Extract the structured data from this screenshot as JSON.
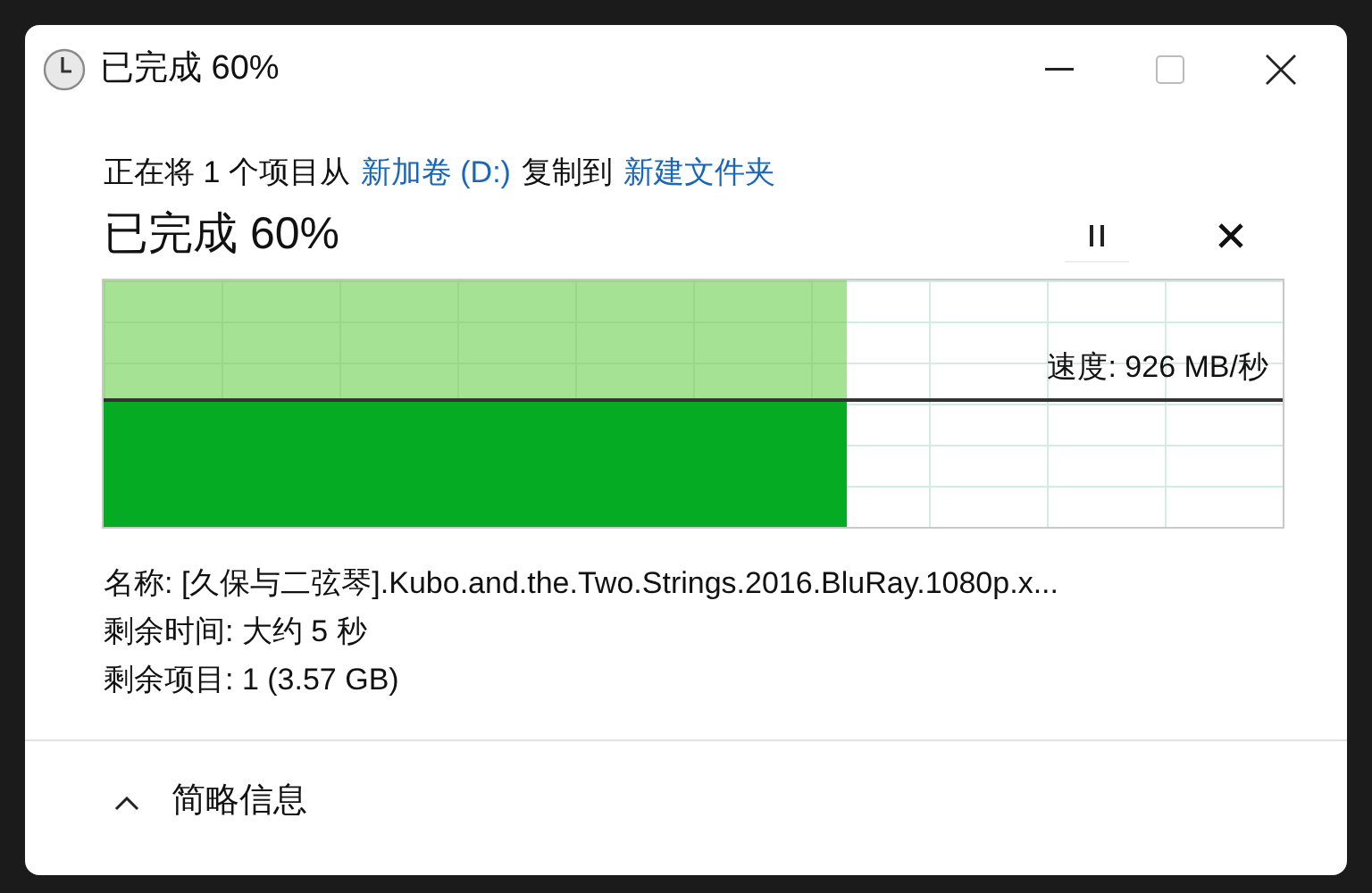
{
  "window": {
    "title": "已完成 60%"
  },
  "header": {
    "parts": [
      {
        "kind": "text",
        "text": "正在将 1 个项目从"
      },
      {
        "kind": "link",
        "text": "新加卷 (D:)"
      },
      {
        "kind": "text",
        "text": "复制到"
      },
      {
        "kind": "link",
        "text": "新建文件夹"
      }
    ]
  },
  "progress": {
    "title": "已完成 60%",
    "speed": "速度: 926 MB/秒"
  },
  "details": [
    "名称: [久保与二弦琴].Kubo.and.the.Two.Strings.2016.BluRay.1080p.x...",
    "剩余时间: 大约 5 秒",
    "剩余项目: 1 (3.57 GB)"
  ],
  "footer": {
    "toggle": "简略信息",
    "expanded": true
  }
}
